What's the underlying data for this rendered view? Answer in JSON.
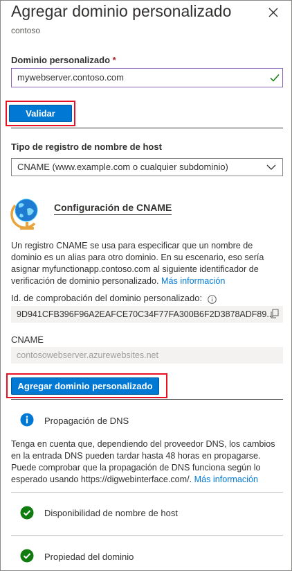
{
  "header": {
    "title": "Agregar dominio personalizado",
    "subtitle": "contoso",
    "close_icon": "close-icon"
  },
  "domain": {
    "label": "Dominio personalizado",
    "required_mark": "*",
    "value": "mywebserver.contoso.com",
    "validate_label": "Validar"
  },
  "host_record": {
    "label": "Tipo de registro de nombre de host",
    "selected": "CNAME (www.example.com o cualquier subdominio)"
  },
  "cname": {
    "title": "Configuración de CNAME",
    "description": "Un registro CNAME se usa para especificar que un nombre de dominio es un alias para otro dominio. En su escenario, eso sería asignar myfunctionapp.contoso.com al siguiente identificador de verificación de dominio personalizado.",
    "more_info": "Más información",
    "verification_label": "Id. de comprobación del dominio personalizado:",
    "verification_value": "9D941CFB396F96A2EAFCE70C34F77FA300B6F2D3878ADF89...",
    "cname_label": "CNAME",
    "cname_value": "contosowebserver.azurewebsites.net"
  },
  "actions": {
    "add_label": "Agregar dominio personalizado"
  },
  "dns": {
    "title": "Propagación de DNS",
    "description": "Tenga en cuenta que, dependiendo del proveedor DNS, los cambios en la entrada DNS pueden tardar hasta 48 horas en propagarse. Puede comprobar que la propagación de DNS funciona según lo esperado usando https://digwebinterface.com/.",
    "more_info": "Más información"
  },
  "checks": [
    {
      "label": "Disponibilidad de nombre de host",
      "icon": "check-circle-icon"
    },
    {
      "label": "Propiedad del dominio",
      "icon": "check-circle-icon"
    }
  ],
  "colors": {
    "accent": "#0078d4",
    "success": "#107c10",
    "highlight": "#e81123",
    "input_focus": "#8764b8"
  }
}
